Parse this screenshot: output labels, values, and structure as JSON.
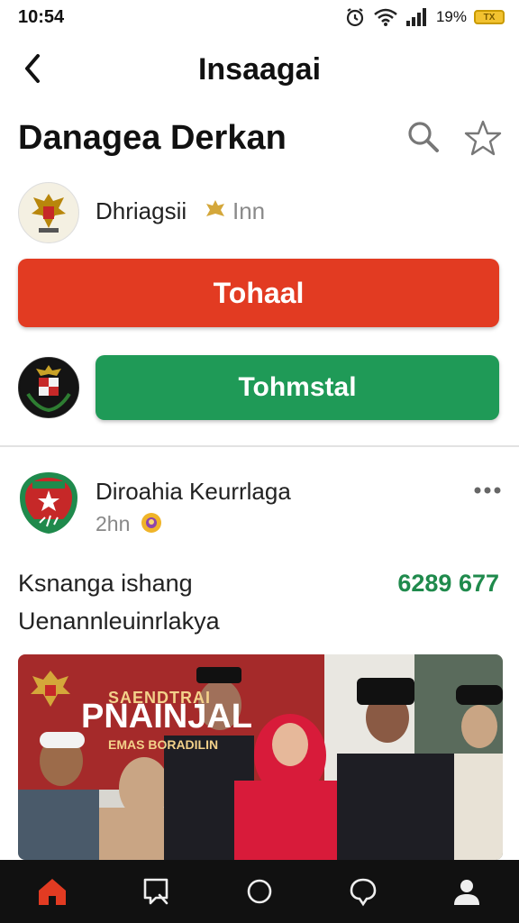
{
  "status_bar": {
    "time": "10:54",
    "battery_text": "19%",
    "battery_label": "TX"
  },
  "header": {
    "title": "Insaagai"
  },
  "page": {
    "title": "Danagea Derkan"
  },
  "org": {
    "name": "Dhriagsii",
    "status": "Inn"
  },
  "buttons": {
    "primary": "Tohaal",
    "secondary": "Tohmstal"
  },
  "post": {
    "author": "Diroahia Keurrlaga",
    "time": "2hn",
    "line1": "Ksnanga ishang",
    "count": "6289 677",
    "line2": "Uenannleuinrlakya",
    "banner_line1": "SAENDTRAI",
    "banner_line2": "PNAINJAL",
    "banner_line3": "EMAS BORADILIN"
  },
  "colors": {
    "primary_red": "#e23b22",
    "secondary_green": "#1f9a57",
    "count_green": "#1f8a4c",
    "nav_active": "#e23b22"
  },
  "nav": [
    {
      "icon": "home-icon",
      "active": true
    },
    {
      "icon": "search-bubble-icon",
      "active": false
    },
    {
      "icon": "circle-icon",
      "active": false
    },
    {
      "icon": "notification-bubble-icon",
      "active": false
    },
    {
      "icon": "profile-icon",
      "active": false
    }
  ]
}
